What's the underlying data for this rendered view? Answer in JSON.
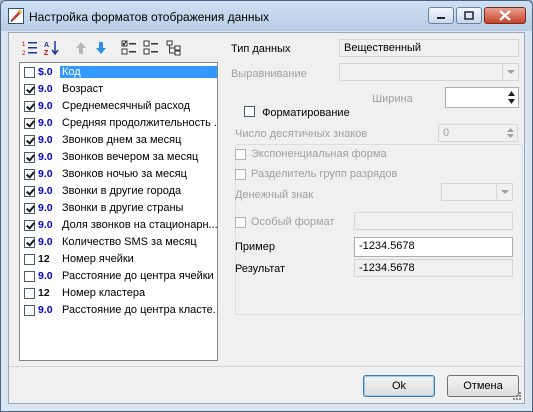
{
  "window": {
    "title": "Настройка форматов отображения данных"
  },
  "toolbar": {
    "icons": [
      "numbered-list-icon",
      "sort-az-icon",
      "move-up-icon",
      "move-down-icon",
      "check-all-icon",
      "uncheck-all-icon",
      "tree-icon"
    ]
  },
  "fields": [
    {
      "label": "Код",
      "type_badge": "$.0",
      "checked": false,
      "selected": true,
      "kind": "num"
    },
    {
      "label": "Возраст",
      "type_badge": "9.0",
      "checked": true,
      "kind": "num"
    },
    {
      "label": "Среднемесячный расход",
      "type_badge": "9.0",
      "checked": true,
      "kind": "num"
    },
    {
      "label": "Средняя продолжительность ...",
      "type_badge": "9.0",
      "checked": true,
      "kind": "num"
    },
    {
      "label": "Звонков днем за месяц",
      "type_badge": "9.0",
      "checked": true,
      "kind": "num"
    },
    {
      "label": "Звонков вечером за месяц",
      "type_badge": "9.0",
      "checked": true,
      "kind": "num"
    },
    {
      "label": "Звонков ночью за месяц",
      "type_badge": "9.0",
      "checked": true,
      "kind": "num"
    },
    {
      "label": "Звонки в другие города",
      "type_badge": "9.0",
      "checked": true,
      "kind": "num"
    },
    {
      "label": "Звонки в другие страны",
      "type_badge": "9.0",
      "checked": true,
      "kind": "num"
    },
    {
      "label": "Доля звонков на стационарн...",
      "type_badge": "9.0",
      "checked": true,
      "kind": "num"
    },
    {
      "label": "Количество SMS за месяц",
      "type_badge": "9.0",
      "checked": true,
      "kind": "num"
    },
    {
      "label": "Номер ячейки",
      "type_badge": "12",
      "checked": false,
      "kind": "int"
    },
    {
      "label": "Расстояние до центра ячейки",
      "type_badge": "9.0",
      "checked": false,
      "kind": "num"
    },
    {
      "label": "Номер кластера",
      "type_badge": "12",
      "checked": false,
      "kind": "int"
    },
    {
      "label": "Расстояние до центра класте...",
      "type_badge": "9.0",
      "checked": false,
      "kind": "num"
    }
  ],
  "props": {
    "data_type_label": "Тип данных",
    "data_type_value": "Вещественный",
    "align_label": "Выравнивание",
    "width_label": "Ширина",
    "formatting_label": "Форматирование",
    "decimals_label": "Число десятичных знаков",
    "decimals_value": "0",
    "exp_label": "Экспоненциальная форма",
    "thousands_label": "Разделитель групп разрядов",
    "currency_label": "Денежный знак",
    "custom_label": "Особый формат",
    "example_label": "Пример",
    "example_value": "-1234.5678",
    "result_label": "Результат",
    "result_value": "-1234.5678"
  },
  "buttons": {
    "ok": "Ok",
    "cancel": "Отмена"
  },
  "colors": {
    "selection": "#3399ff",
    "badge_blue": "#0000cc"
  }
}
